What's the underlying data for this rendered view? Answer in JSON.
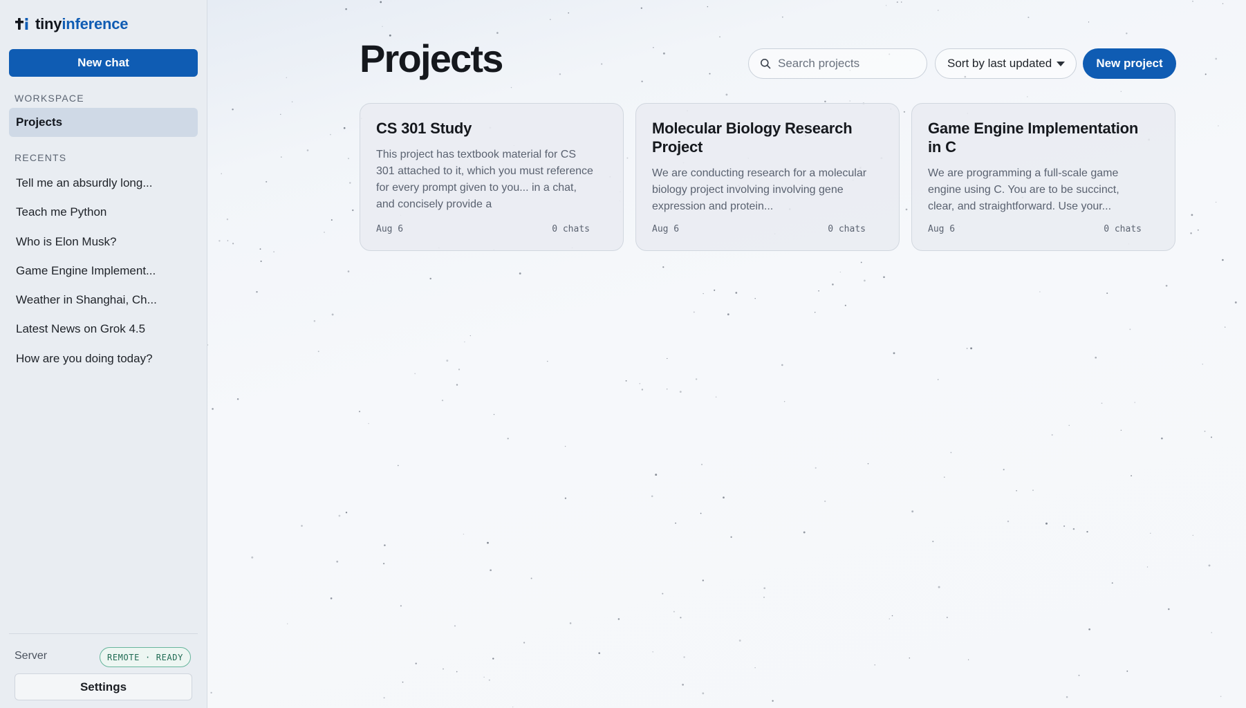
{
  "brand": {
    "part1": "tiny",
    "part2": "inference"
  },
  "sidebar": {
    "new_chat_label": "New chat",
    "workspace_label": "WORKSPACE",
    "projects_label": "Projects",
    "recents_label": "RECENTS",
    "recents": [
      "Tell me an absurdly long...",
      "Teach me Python",
      "Who is Elon Musk?",
      "Game Engine Implement...",
      "Weather in Shanghai, Ch...",
      "Latest News on Grok 4.5",
      "How are you doing today?"
    ],
    "server_label": "Server",
    "server_mode": "REMOTE",
    "server_sep": "·",
    "server_status": "READY",
    "settings_label": "Settings"
  },
  "main": {
    "title": "Projects",
    "search_placeholder": "Search projects",
    "sort_label": "Sort by last updated",
    "new_project_label": "New project",
    "projects": [
      {
        "title": "CS 301 Study",
        "description": "This project has textbook material for CS 301 attached to it, which you must reference for every prompt given to you... in a chat, and concisely provide a",
        "date": "Aug 6",
        "chats": "0 chats"
      },
      {
        "title": "Molecular Biology Research Project",
        "description": "We are conducting research for a molecular biology project involving involving gene expression and protein...",
        "date": "Aug 6",
        "chats": "0 chats"
      },
      {
        "title": "Game Engine Implementation in C",
        "description": "We are programming a full-scale game engine using C. You are to be succinct, clear, and straightforward. Use your...",
        "date": "Aug 6",
        "chats": "0 chats"
      }
    ]
  },
  "colors": {
    "accent": "#0f5cb3",
    "sidebar_bg": "#e9edf2",
    "active_nav": "#cfd9e6",
    "status_green": "#1f6a52"
  },
  "icons": {
    "brand": "brand-logo-icon",
    "search": "search-icon",
    "sort": "chevron-down-icon"
  }
}
